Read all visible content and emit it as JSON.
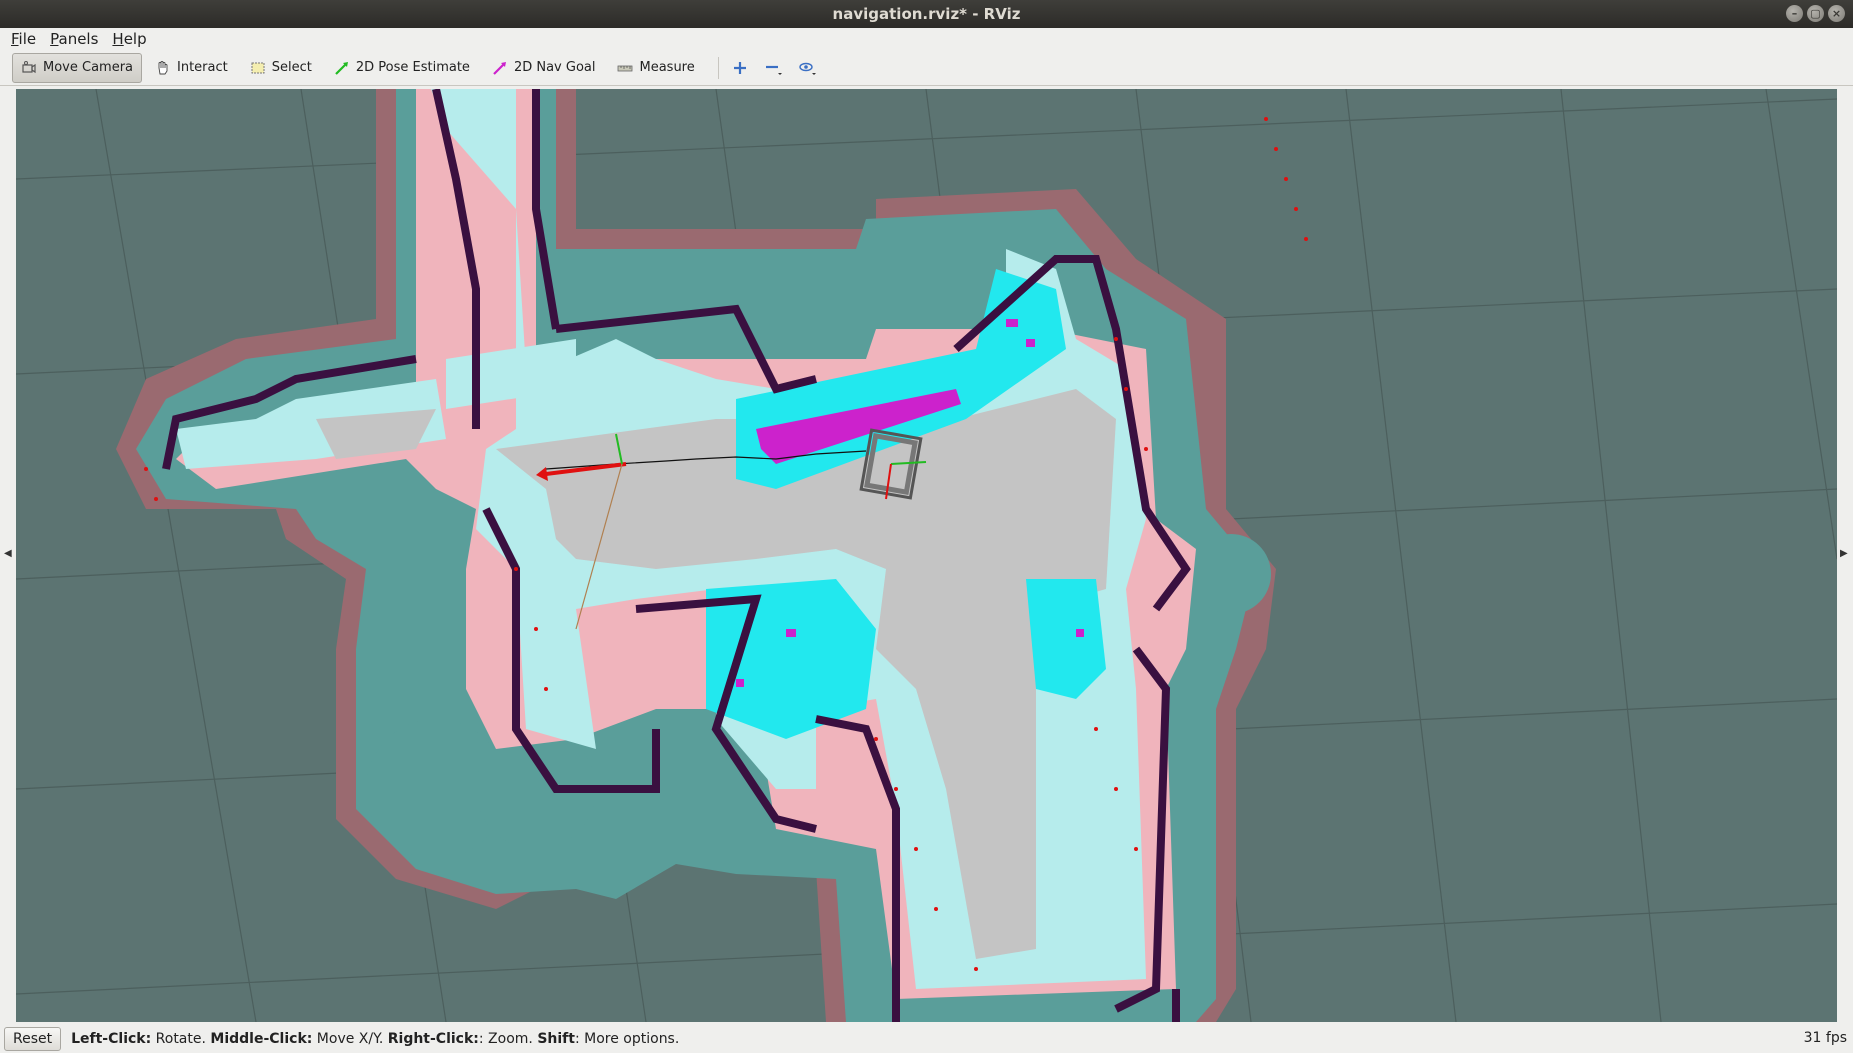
{
  "window": {
    "title": "navigation.rviz* - RViz",
    "buttons": [
      "–",
      "▢",
      "×"
    ]
  },
  "menu": [
    {
      "label": "File",
      "mnemonic": "F",
      "rest": "ile"
    },
    {
      "label": "Panels",
      "mnemonic": "P",
      "rest": "anels"
    },
    {
      "label": "Help",
      "mnemonic": "H",
      "rest": "elp"
    }
  ],
  "toolbar": {
    "tools": [
      {
        "label": "Move Camera",
        "icon": "move-camera-icon",
        "active": true
      },
      {
        "label": "Interact",
        "icon": "hand-icon",
        "active": false
      },
      {
        "label": "Select",
        "icon": "select-box-icon",
        "active": false
      },
      {
        "label": "2D Pose Estimate",
        "icon": "green-arrow-icon",
        "active": false
      },
      {
        "label": "2D Nav Goal",
        "icon": "magenta-arrow-icon",
        "active": false
      },
      {
        "label": "Measure",
        "icon": "ruler-icon",
        "active": false
      }
    ],
    "extra_icons": [
      "add-tool-icon",
      "remove-tool-icon",
      "view-eye-icon"
    ],
    "colors": {
      "pose": "#22bb22",
      "goal": "#cc22cc"
    }
  },
  "status": {
    "reset_label": "Reset",
    "hint": [
      {
        "bold": "Left-Click:",
        "text": " Rotate. "
      },
      {
        "bold": "Middle-Click:",
        "text": " Move X/Y. "
      },
      {
        "bold": "Right-Click:",
        "text": ": Zoom. "
      },
      {
        "bold": "Shift",
        "text": ": More options."
      }
    ],
    "fps": "31 fps"
  },
  "map_colors": {
    "background": "#5c7472",
    "grid": "#4a5a58",
    "inflation_outer": "#9a6a70",
    "inflation_teal": "#5a9e9a",
    "pink": "#f0b4bc",
    "light_cyan": "#b6ecec",
    "free": "#c4c4c4",
    "wall": "#3a1040",
    "cyan": "#22e8ee",
    "magenta": "#cc22cc",
    "laser": "#e01010"
  }
}
